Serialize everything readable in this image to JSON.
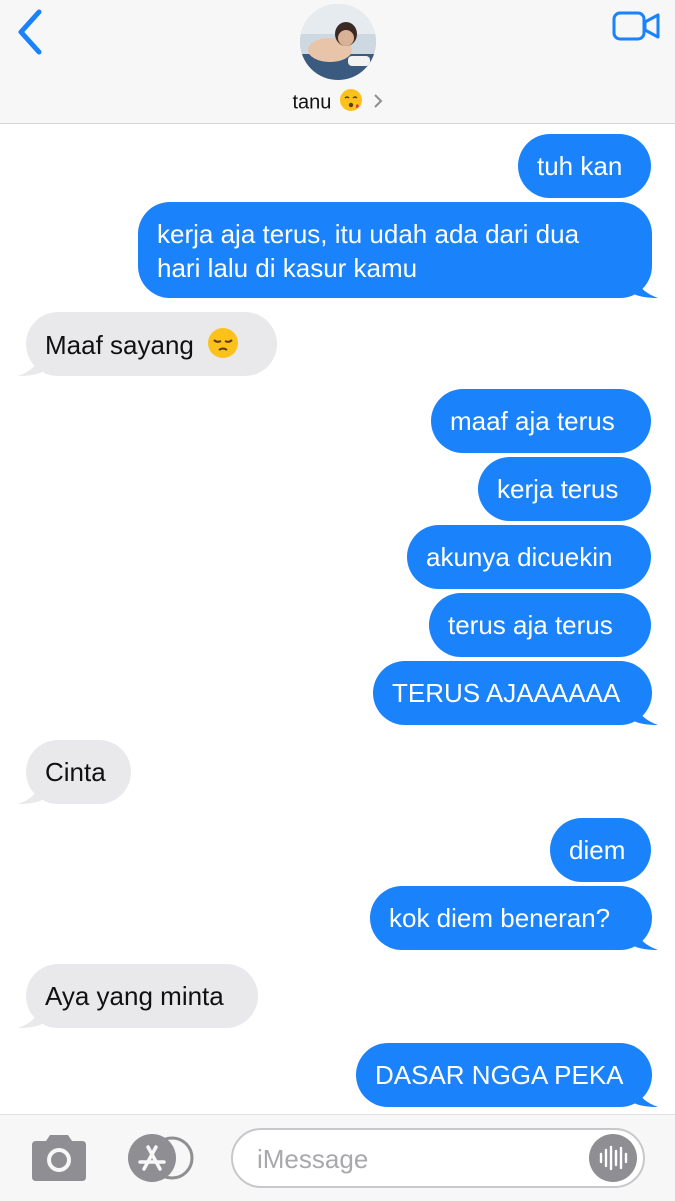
{
  "header": {
    "contact_name": "tanu",
    "contact_emoji": "😚",
    "back_icon": "chevron-left-icon",
    "video_icon": "video-camera-icon",
    "accent_color": "#1a82fb"
  },
  "messages": [
    {
      "side": "sent",
      "text": "tuh kan"
    },
    {
      "side": "sent",
      "line1": "kerja aja terus, itu udah ada dari dua",
      "line2": "hari lalu di kasur kamu"
    },
    {
      "side": "received",
      "text": "Maaf sayang",
      "emoji": "😔"
    },
    {
      "side": "sent",
      "text": "maaf aja terus"
    },
    {
      "side": "sent",
      "text": "kerja terus"
    },
    {
      "side": "sent",
      "text": "akunya dicuekin"
    },
    {
      "side": "sent",
      "text": "terus aja terus"
    },
    {
      "side": "sent",
      "text": "TERUS AJAAAAAA"
    },
    {
      "side": "received",
      "text": "Cinta"
    },
    {
      "side": "sent",
      "text": "diem"
    },
    {
      "side": "sent",
      "text": "kok diem beneran?"
    },
    {
      "side": "received",
      "text": "Aya yang minta"
    },
    {
      "side": "sent",
      "text": "DASAR NGGA PEKA"
    }
  ],
  "composer": {
    "placeholder": "iMessage",
    "camera_icon": "camera-icon",
    "appstore_icon": "app-store-icon",
    "audio_icon": "audio-waveform-icon"
  },
  "colors": {
    "sent_bubble": "#1a82fb",
    "received_bubble": "#e9e9eb"
  }
}
